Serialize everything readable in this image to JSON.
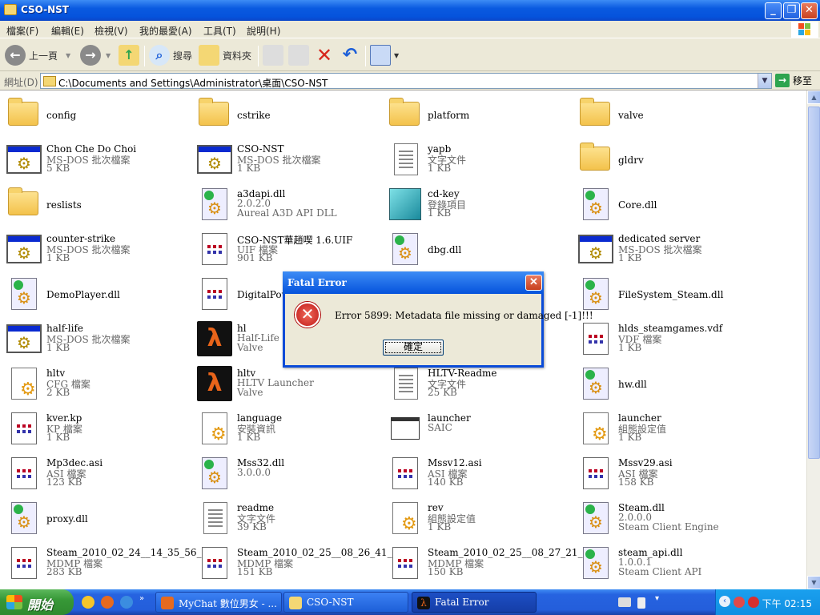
{
  "window": {
    "title": "CSO-NST",
    "min_label": "_",
    "max_label": "❐",
    "close_label": "✕"
  },
  "menu": [
    "檔案(F)",
    "編輯(E)",
    "檢視(V)",
    "我的最愛(A)",
    "工具(T)",
    "說明(H)"
  ],
  "toolbar": {
    "back_label": "上一頁",
    "search_label": "搜尋",
    "folders_label": "資料夾"
  },
  "address": {
    "label": "網址(D)",
    "path": "C:\\Documents and Settings\\Administrator\\桌面\\CSO-NST",
    "go_label": "移至"
  },
  "items": [
    {
      "icon": "folder",
      "name": "config"
    },
    {
      "icon": "folder",
      "name": "cstrike"
    },
    {
      "icon": "folder",
      "name": "platform"
    },
    {
      "icon": "folder",
      "name": "valve"
    },
    {
      "icon": "bat",
      "name": "Chon Che Do Choi",
      "type": "MS-DOS 批次檔案",
      "size": "5 KB"
    },
    {
      "icon": "bat",
      "name": "CSO-NST",
      "type": "MS-DOS 批次檔案",
      "size": "1 KB"
    },
    {
      "icon": "doc",
      "name": "yapb",
      "type": "文字文件",
      "size": "1 KB"
    },
    {
      "icon": "folder",
      "name": "gldrv"
    },
    {
      "icon": "folder",
      "name": "reslists"
    },
    {
      "icon": "dll",
      "name": "a3dapi.dll",
      "type": "2.0.2.0",
      "size": "Aureal A3D API DLL"
    },
    {
      "icon": "reg",
      "name": "cd-key",
      "type": "登錄項目",
      "size": "1 KB"
    },
    {
      "icon": "dll",
      "name": "Core.dll"
    },
    {
      "icon": "bat",
      "name": "counter-strike",
      "type": "MS-DOS 批次檔案",
      "size": "1 KB"
    },
    {
      "icon": "grid",
      "name": "CSO-NST華趙喫 1.6.UIF",
      "type": "UIF 檔案",
      "size": "901 KB"
    },
    {
      "icon": "dll",
      "name": "dbg.dll"
    },
    {
      "icon": "bat",
      "name": "dedicated server",
      "type": "MS-DOS 批次檔案",
      "size": "1 KB"
    },
    {
      "icon": "dll",
      "name": "DemoPlayer.dll"
    },
    {
      "icon": "grid",
      "name": "DigitalPowe"
    },
    {
      "icon": "dll",
      "name": ""
    },
    {
      "icon": "dll",
      "name": "FileSystem_Steam.dll"
    },
    {
      "icon": "bat",
      "name": "half-life",
      "type": "MS-DOS 批次檔案",
      "size": "1 KB"
    },
    {
      "icon": "hl",
      "name": "hl",
      "type": "Half-Life La",
      "size": "Valve"
    },
    {
      "icon": "doc",
      "name": ""
    },
    {
      "icon": "grid",
      "name": "hlds_steamgames.vdf",
      "type": "VDF 檔案",
      "size": "1 KB"
    },
    {
      "icon": "setini",
      "name": "hltv",
      "type": "CFG 檔案",
      "size": "2 KB"
    },
    {
      "icon": "hl",
      "name": "hltv",
      "type": "HLTV Launcher",
      "size": "Valve"
    },
    {
      "icon": "doc",
      "name": "HLTV-Readme",
      "type": "文字文件",
      "size": "25 KB"
    },
    {
      "icon": "dll",
      "name": "hw.dll"
    },
    {
      "icon": "grid",
      "name": "kver.kp",
      "type": "KP 檔案",
      "size": "1 KB"
    },
    {
      "icon": "setini",
      "name": "language",
      "type": "安裝資訊",
      "size": "1 KB"
    },
    {
      "icon": "launcher",
      "name": "launcher",
      "type": "SAIC"
    },
    {
      "icon": "setini",
      "name": "launcher",
      "type": "組態設定值",
      "size": "1 KB"
    },
    {
      "icon": "grid",
      "name": "Mp3dec.asi",
      "type": "ASI 檔案",
      "size": "123 KB"
    },
    {
      "icon": "dll",
      "name": "Mss32.dll",
      "type": "3.0.0.0"
    },
    {
      "icon": "grid",
      "name": "Mssv12.asi",
      "type": "ASI 檔案",
      "size": "140 KB"
    },
    {
      "icon": "grid",
      "name": "Mssv29.asi",
      "type": "ASI 檔案",
      "size": "158 KB"
    },
    {
      "icon": "dll",
      "name": "proxy.dll"
    },
    {
      "icon": "doc",
      "name": "readme",
      "type": "文字文件",
      "size": "39 KB"
    },
    {
      "icon": "setini",
      "name": "rev",
      "type": "組態設定值",
      "size": "1 KB"
    },
    {
      "icon": "dll",
      "name": "Steam.dll",
      "type": "2.0.0.0",
      "size": "Steam Client Engine"
    },
    {
      "icon": "grid",
      "name": "Steam_2010_02_24__14_35_56_7...",
      "type": "MDMP 檔案",
      "size": "283 KB"
    },
    {
      "icon": "grid",
      "name": "Steam_2010_02_25__08_26_41_0...",
      "type": "MDMP 檔案",
      "size": "151 KB"
    },
    {
      "icon": "grid",
      "name": "Steam_2010_02_25__08_27_21_5...",
      "type": "MDMP 檔案",
      "size": "150 KB"
    },
    {
      "icon": "dll",
      "name": "steam_api.dll",
      "type": "1.0.0.1",
      "size": "Steam Client API"
    }
  ],
  "dialog": {
    "title": "Fatal Error",
    "close_label": "✕",
    "icon_glyph": "✕",
    "message": "Error 5899:  Metadata file missing or damaged [-1]!!!",
    "ok_label": "確定"
  },
  "taskbar": {
    "start_label": "開始",
    "tasks": [
      "MyChat 數位男女 - ...",
      "CSO-NST",
      "Fatal Error"
    ],
    "clock": "下午 02:15"
  },
  "colors": {
    "accent": "#0553dc",
    "taskbar": "#245edb",
    "start": "#379837"
  }
}
